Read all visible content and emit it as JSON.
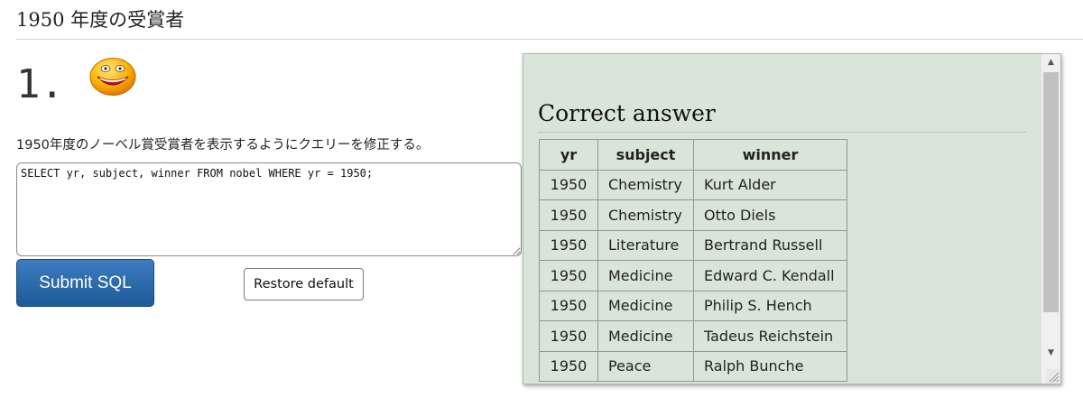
{
  "header": {
    "title": "1950 年度の受賞者"
  },
  "question": {
    "number": "1.",
    "status_icon": "smiley-face-icon",
    "prompt": "1950年度のノーベル賞受賞者を表示するようにクエリーを修正する。",
    "sql_value": "SELECT yr, subject, winner FROM nobel WHERE yr = 1950;"
  },
  "buttons": {
    "submit_label": "Submit SQL",
    "restore_label": "Restore default"
  },
  "answer": {
    "title": "Correct answer",
    "columns": [
      "yr",
      "subject",
      "winner"
    ],
    "rows": [
      [
        "1950",
        "Chemistry",
        "Kurt Alder"
      ],
      [
        "1950",
        "Chemistry",
        "Otto Diels"
      ],
      [
        "1950",
        "Literature",
        "Bertrand Russell"
      ],
      [
        "1950",
        "Medicine",
        "Edward C. Kendall"
      ],
      [
        "1950",
        "Medicine",
        "Philip S. Hench"
      ],
      [
        "1950",
        "Medicine",
        "Tadeus Reichstein"
      ],
      [
        "1950",
        "Peace",
        "Ralph Bunche"
      ]
    ]
  },
  "colors": {
    "panel_bg": "#d9e5d9",
    "submit_bg": "#2a6aab"
  }
}
